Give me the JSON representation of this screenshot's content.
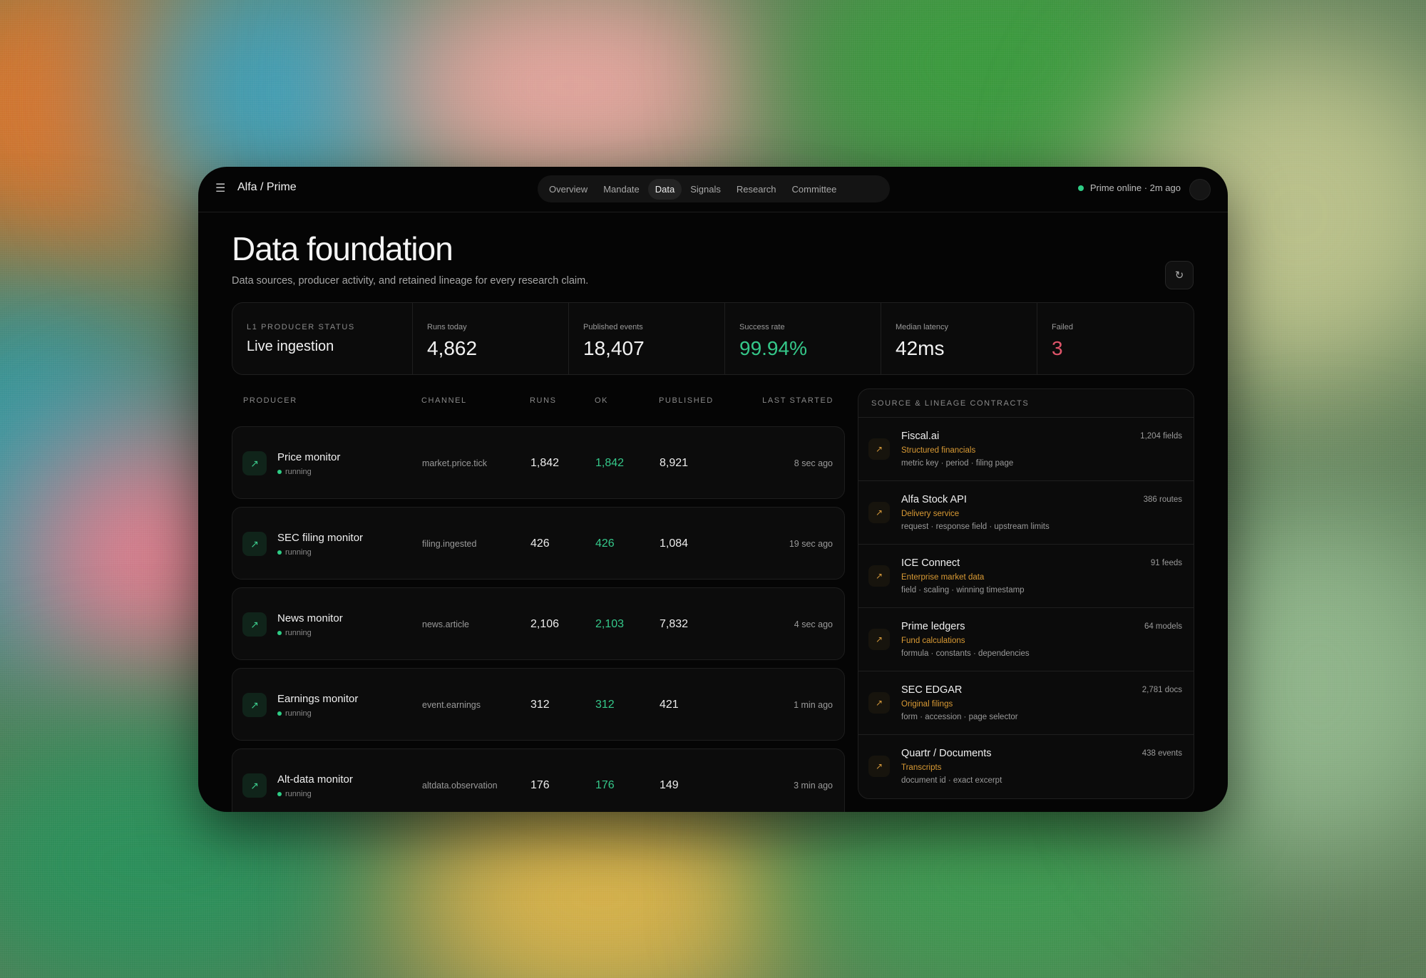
{
  "app": {
    "brand": "Alfa / Prime",
    "status_text": "Prime online · 2m ago",
    "status_color": "#2ecc85"
  },
  "nav": {
    "tabs": [
      {
        "label": "Overview",
        "active": false
      },
      {
        "label": "Mandate",
        "active": false
      },
      {
        "label": "Data",
        "active": true
      },
      {
        "label": "Signals",
        "active": false
      },
      {
        "label": "Research",
        "active": false
      },
      {
        "label": "Committee",
        "active": false
      }
    ]
  },
  "page": {
    "title": "Data foundation",
    "subtitle": "Data sources, producer activity, and retained lineage for every research claim."
  },
  "icons": {
    "menu": "hamburger-menu-icon",
    "refresh": "refresh-icon",
    "producer": "arrow-up-right-icon",
    "source": "arrow-up-right-icon"
  },
  "stats": {
    "producer_status_label": "L1 Producer Status",
    "producer_status_value": "Live ingestion",
    "runs_today_label": "Runs today",
    "runs_today_value": "4,862",
    "published_events_label": "Published events",
    "published_events_value": "18,407",
    "success_rate_label": "Success rate",
    "success_rate_value": "99.94%",
    "median_latency_label": "Median latency",
    "median_latency_value": "42ms",
    "failed_label": "Failed",
    "failed_value": "3"
  },
  "colors": {
    "accent_green": "#35c88a",
    "failed_red": "#e0556a",
    "source_orange": "#d99a34"
  },
  "producers": {
    "headers": {
      "producer": "Producer",
      "channel": "Channel",
      "runs": "Runs",
      "ok": "OK",
      "published": "Published",
      "last_started": "Last started"
    },
    "rows": [
      {
        "name": "Price monitor",
        "state": "running",
        "channel": "market.price.tick",
        "runs": "1,842",
        "ok": "1,842",
        "published": "8,921",
        "last": "8 sec ago"
      },
      {
        "name": "SEC filing monitor",
        "state": "running",
        "channel": "filing.ingested",
        "runs": "426",
        "ok": "426",
        "published": "1,084",
        "last": "19 sec ago"
      },
      {
        "name": "News monitor",
        "state": "running",
        "channel": "news.article",
        "runs": "2,106",
        "ok": "2,103",
        "published": "7,832",
        "last": "4 sec ago"
      },
      {
        "name": "Earnings monitor",
        "state": "running",
        "channel": "event.earnings",
        "runs": "312",
        "ok": "312",
        "published": "421",
        "last": "1 min ago"
      },
      {
        "name": "Alt-data monitor",
        "state": "running",
        "channel": "altdata.observation",
        "runs": "176",
        "ok": "176",
        "published": "149",
        "last": "3 min ago"
      }
    ]
  },
  "lineage": {
    "header": "Source & lineage contracts",
    "sources": [
      {
        "name": "Fiscal.ai",
        "kind": "Structured financials",
        "fields": "metric key · period · filing page",
        "count": "1,204 fields"
      },
      {
        "name": "Alfa Stock API",
        "kind": "Delivery service",
        "fields": "request · response field · upstream limits",
        "count": "386 routes"
      },
      {
        "name": "ICE Connect",
        "kind": "Enterprise market data",
        "fields": "field · scaling · winning timestamp",
        "count": "91 feeds"
      },
      {
        "name": "Prime ledgers",
        "kind": "Fund calculations",
        "fields": "formula · constants · dependencies",
        "count": "64 models"
      },
      {
        "name": "SEC EDGAR",
        "kind": "Original filings",
        "fields": "form · accession · page selector",
        "count": "2,781 docs"
      },
      {
        "name": "Quartr / Documents",
        "kind": "Transcripts",
        "fields": "document id · exact excerpt",
        "count": "438 events"
      }
    ]
  }
}
